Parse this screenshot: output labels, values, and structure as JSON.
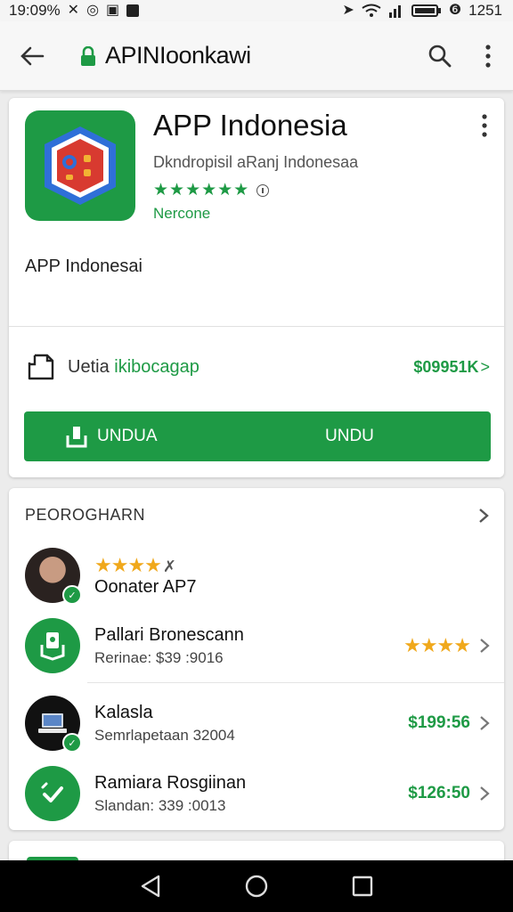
{
  "status_bar": {
    "time": "19:09%",
    "right_text": "1251"
  },
  "app_bar": {
    "title": "APINIoonkawi"
  },
  "app": {
    "name": "APP Indonesia",
    "developer": "Dkndropisil aRanj Indonesaa",
    "stars": "★★★★★★",
    "tag": "Nercone",
    "description": "APP Indonesai"
  },
  "permission": {
    "label_plain": "Uetia ",
    "label_green": "ikibocagap",
    "value": "$09951K",
    "chevron": ">"
  },
  "download": {
    "label_left": "UNDUA",
    "label_right": "UNDU"
  },
  "section": {
    "title": "PEOROGHARN"
  },
  "list": [
    {
      "title": "Oonater AP7",
      "subtitle": "",
      "stars": "★★★★",
      "star_extra": "✗",
      "right": ""
    },
    {
      "title": "Pallari Bronescann",
      "subtitle": "Rerinae: $39 :9016",
      "stars": "★★★★",
      "right": ""
    },
    {
      "title": "Kalasla",
      "subtitle": "Semrlapetaan 32004",
      "right": "$199:56"
    },
    {
      "title": "Ramiara Rosgiinan",
      "subtitle": "Slandan: 339 :0013",
      "right": "$126:50"
    }
  ],
  "colors": {
    "accent_green": "#1e9a45",
    "star_gold": "#f0a81b"
  }
}
